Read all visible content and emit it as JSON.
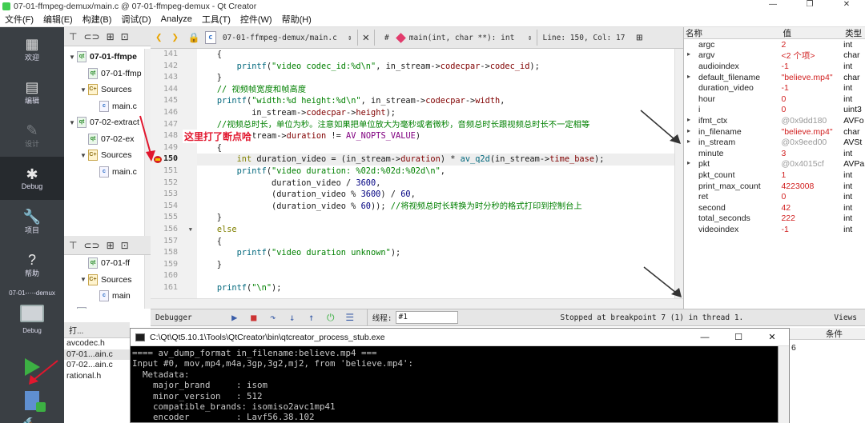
{
  "window": {
    "title": "07-01-ffmpeg-demux/main.c @ 07-01-ffmpeg-demux - Qt Creator",
    "controls": [
      "—",
      "❐",
      "✕"
    ]
  },
  "menu": [
    "文件(F)",
    "编辑(E)",
    "构建(B)",
    "调试(D)",
    "Analyze",
    "工具(T)",
    "控件(W)",
    "帮助(H)"
  ],
  "modes": [
    {
      "label": "欢迎",
      "icon": "▦"
    },
    {
      "label": "编辑",
      "icon": "▤"
    },
    {
      "label": "设计",
      "icon": "✎"
    },
    {
      "label": "Debug",
      "icon": "✱"
    },
    {
      "label": "项目",
      "icon": "🔧"
    },
    {
      "label": "帮助",
      "icon": "?"
    }
  ],
  "kit": {
    "name": "07-01-···-demux",
    "mode": "Debug"
  },
  "project_tree_top": [
    {
      "label": "07-01-ffmpe",
      "level": 0,
      "arrow": "▼",
      "icon": "pro",
      "bold": true
    },
    {
      "label": "07-01-ffmp",
      "level": 1,
      "arrow": "",
      "icon": "pro"
    },
    {
      "label": "Sources",
      "level": 1,
      "arrow": "▼",
      "icon": "folder"
    },
    {
      "label": "main.c",
      "level": 2,
      "arrow": "",
      "icon": "c"
    },
    {
      "label": "07-02-extract",
      "level": 0,
      "arrow": "▼",
      "icon": "pro"
    },
    {
      "label": "07-02-ex",
      "level": 1,
      "arrow": "",
      "icon": "pro"
    },
    {
      "label": "Sources",
      "level": 1,
      "arrow": "▼",
      "icon": "folder"
    },
    {
      "label": "main.c",
      "level": 2,
      "arrow": "",
      "icon": "c"
    }
  ],
  "project_tree_bottom": [
    {
      "label": "07-01-ff",
      "level": 1,
      "arrow": "",
      "icon": "pro"
    },
    {
      "label": "Sources",
      "level": 1,
      "arrow": "▼",
      "icon": "folder"
    },
    {
      "label": "main",
      "level": 2,
      "arrow": "",
      "icon": "c"
    },
    {
      "label": "07-02-",
      "level": 0,
      "arrow": "▼",
      "icon": "pro"
    }
  ],
  "editor": {
    "file": "07-01-ffmpeg-demux/main.c",
    "hash": "#",
    "symbol": "main(int, char **): int",
    "position": "Line: 150, Col: 17",
    "line_numbers": [
      "141",
      "142",
      "143",
      "144",
      "145",
      "146",
      "147",
      "148",
      "149",
      "150",
      "151",
      "152",
      "153",
      "154",
      "155",
      "156",
      "157",
      "158",
      "159",
      "160",
      "161"
    ],
    "current_line_index": 9
  },
  "annotation": "这里打了断点哈",
  "variables": {
    "headers": [
      "名称",
      "值",
      "类型"
    ],
    "rows": [
      {
        "arrow": "",
        "name": "argc",
        "value": "2",
        "type": "int",
        "grey": false
      },
      {
        "arrow": "▸",
        "name": "argv",
        "value": "<2 个项>",
        "type": "char",
        "grey": false
      },
      {
        "arrow": "",
        "name": "audioindex",
        "value": "-1",
        "type": "int",
        "grey": false
      },
      {
        "arrow": "▸",
        "name": "default_filename",
        "value": "\"believe.mp4\"",
        "type": "char",
        "grey": false
      },
      {
        "arrow": "",
        "name": "duration_video",
        "value": "-1",
        "type": "int",
        "grey": false
      },
      {
        "arrow": "",
        "name": "hour",
        "value": "0",
        "type": "int",
        "grey": false
      },
      {
        "arrow": "",
        "name": "i",
        "value": "0",
        "type": "uint3",
        "grey": false
      },
      {
        "arrow": "▸",
        "name": "ifmt_ctx",
        "value": "@0x9dd180",
        "type": "AVFo",
        "grey": true
      },
      {
        "arrow": "▸",
        "name": "in_filename",
        "value": "\"believe.mp4\"",
        "type": "char",
        "grey": false
      },
      {
        "arrow": "▸",
        "name": "in_stream",
        "value": "@0x9eed00",
        "type": "AVSt",
        "grey": true
      },
      {
        "arrow": "",
        "name": "minute",
        "value": "3",
        "type": "int",
        "grey": false
      },
      {
        "arrow": "▸",
        "name": "pkt",
        "value": "@0x4015cf",
        "type": "AVPa",
        "grey": true
      },
      {
        "arrow": "",
        "name": "pkt_count",
        "value": "1",
        "type": "int",
        "grey": false
      },
      {
        "arrow": "",
        "name": "print_max_count",
        "value": "4223008",
        "type": "int",
        "grey": false
      },
      {
        "arrow": "",
        "name": "ret",
        "value": "0",
        "type": "int",
        "grey": false
      },
      {
        "arrow": "",
        "name": "second",
        "value": "42",
        "type": "int",
        "grey": false
      },
      {
        "arrow": "",
        "name": "total_seconds",
        "value": "222",
        "type": "int",
        "grey": false
      },
      {
        "arrow": "",
        "name": "videoindex",
        "value": "-1",
        "type": "int",
        "grey": false
      }
    ]
  },
  "debugger_bar": {
    "label": "Debugger",
    "thread_label": "线程:",
    "thread_value": "#1",
    "status": "Stopped at breakpoint 7 (1) in thread 1.",
    "views": "Views"
  },
  "open_files": {
    "header": "打...",
    "items": [
      "avcodec.h",
      "07-01...ain.c",
      "07-02...ain.c",
      "rational.h"
    ],
    "selected": 1
  },
  "breakpoints": {
    "header": "条件",
    "row_text": "6"
  },
  "console": {
    "title": "C:\\Qt\\Qt5.10.1\\Tools\\QtCreator\\bin\\qtcreator_process_stub.exe",
    "controls": [
      "—",
      "☐",
      "✕"
    ],
    "lines": [
      "==== av_dump_format in_filename:believe.mp4 ===",
      "Input #0, mov,mp4,m4a,3gp,3g2,mj2, from 'believe.mp4':",
      "  Metadata:",
      "    major_brand     : isom",
      "    minor_version   : 512",
      "    compatible_brands: isomiso2avc1mp41",
      "    encoder         : Lavf56.38.102"
    ]
  },
  "colors": {
    "annotation": "#e1172e",
    "modebar": "#3a3f44",
    "accent": "#e8a400"
  }
}
